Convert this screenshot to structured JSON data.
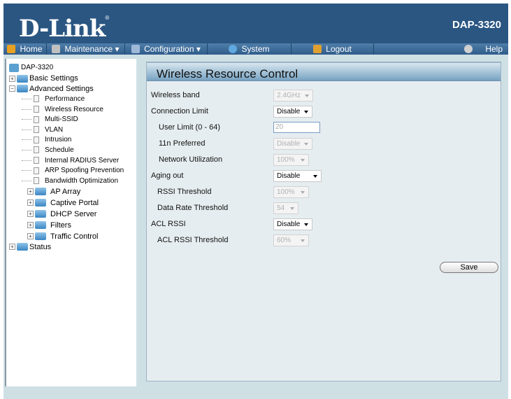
{
  "header": {
    "logo": "D-Link",
    "model": "DAP-3320"
  },
  "nav": [
    {
      "label": "Home",
      "icon": "home-icon",
      "color": "#e8a020"
    },
    {
      "label": "Maintenance ▾",
      "icon": "tools-icon",
      "color": "#c0c0c0"
    },
    {
      "label": "Configuration ▾",
      "icon": "floppy-icon",
      "color": "#a0b8d8"
    },
    {
      "label": "System",
      "icon": "system-icon",
      "color": "#60a8e0"
    },
    {
      "label": "Logout",
      "icon": "logout-icon",
      "color": "#e0a030"
    },
    {
      "label": "Help",
      "icon": "help-icon",
      "color": "#d0d0d0"
    }
  ],
  "tree": {
    "root": "DAP-3320",
    "basic": "Basic Settings",
    "advanced": "Advanced Settings",
    "pages": [
      "Performance",
      "Wireless Resource",
      "Multi-SSID",
      "VLAN",
      "Intrusion",
      "Schedule",
      "Internal RADIUS Server",
      "ARP Spoofing Prevention",
      "Bandwidth Optimization"
    ],
    "folders": [
      "AP Array",
      "Captive Portal",
      "DHCP Server",
      "Filters",
      "Traffic Control"
    ],
    "status": "Status"
  },
  "form": {
    "title": "Wireless Resource Control",
    "wireless_band": {
      "label": "Wireless band",
      "value": "2.4GHz"
    },
    "connection_limit": {
      "label": "Connection Limit",
      "value": "Disable"
    },
    "user_limit": {
      "label": "User Limit (0 - 64)",
      "value": "20"
    },
    "n_preferred": {
      "label": "11n Preferred",
      "value": "Disable"
    },
    "network_util": {
      "label": "Network Utilization",
      "value": "100%"
    },
    "aging_out": {
      "label": "Aging out",
      "value": "Disable"
    },
    "rssi_threshold": {
      "label": "RSSI Threshold",
      "value": "100%"
    },
    "data_rate": {
      "label": "Data Rate Threshold",
      "value": "54"
    },
    "acl_rssi": {
      "label": "ACL RSSI",
      "value": "Disable"
    },
    "acl_rssi_threshold": {
      "label": "ACL RSSI Threshold",
      "value": "60%"
    },
    "save": "Save"
  }
}
